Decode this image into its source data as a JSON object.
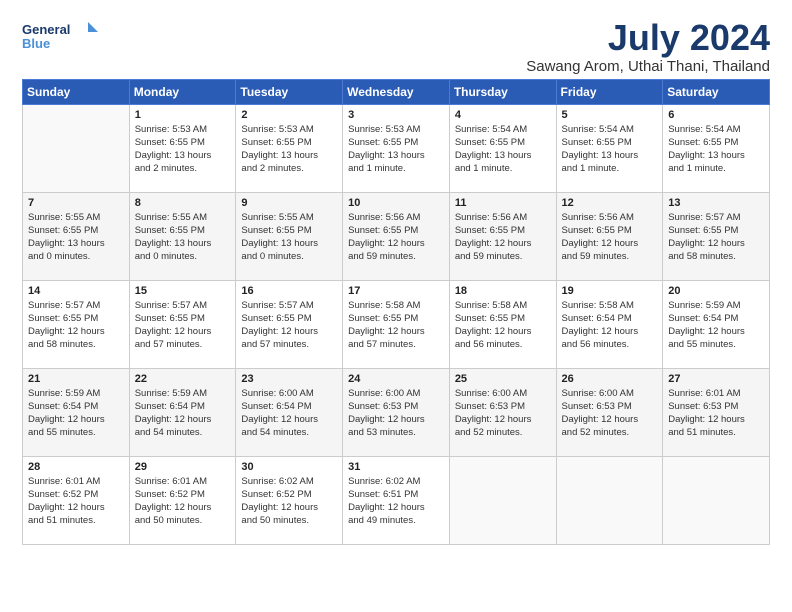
{
  "logo": {
    "line1": "General",
    "line2": "Blue"
  },
  "title": "July 2024",
  "subtitle": "Sawang Arom, Uthai Thani, Thailand",
  "weekdays": [
    "Sunday",
    "Monday",
    "Tuesday",
    "Wednesday",
    "Thursday",
    "Friday",
    "Saturday"
  ],
  "weeks": [
    [
      {
        "day": "",
        "info": ""
      },
      {
        "day": "1",
        "info": "Sunrise: 5:53 AM\nSunset: 6:55 PM\nDaylight: 13 hours\nand 2 minutes."
      },
      {
        "day": "2",
        "info": "Sunrise: 5:53 AM\nSunset: 6:55 PM\nDaylight: 13 hours\nand 2 minutes."
      },
      {
        "day": "3",
        "info": "Sunrise: 5:53 AM\nSunset: 6:55 PM\nDaylight: 13 hours\nand 1 minute."
      },
      {
        "day": "4",
        "info": "Sunrise: 5:54 AM\nSunset: 6:55 PM\nDaylight: 13 hours\nand 1 minute."
      },
      {
        "day": "5",
        "info": "Sunrise: 5:54 AM\nSunset: 6:55 PM\nDaylight: 13 hours\nand 1 minute."
      },
      {
        "day": "6",
        "info": "Sunrise: 5:54 AM\nSunset: 6:55 PM\nDaylight: 13 hours\nand 1 minute."
      }
    ],
    [
      {
        "day": "7",
        "info": "Sunrise: 5:55 AM\nSunset: 6:55 PM\nDaylight: 13 hours\nand 0 minutes."
      },
      {
        "day": "8",
        "info": "Sunrise: 5:55 AM\nSunset: 6:55 PM\nDaylight: 13 hours\nand 0 minutes."
      },
      {
        "day": "9",
        "info": "Sunrise: 5:55 AM\nSunset: 6:55 PM\nDaylight: 13 hours\nand 0 minutes."
      },
      {
        "day": "10",
        "info": "Sunrise: 5:56 AM\nSunset: 6:55 PM\nDaylight: 12 hours\nand 59 minutes."
      },
      {
        "day": "11",
        "info": "Sunrise: 5:56 AM\nSunset: 6:55 PM\nDaylight: 12 hours\nand 59 minutes."
      },
      {
        "day": "12",
        "info": "Sunrise: 5:56 AM\nSunset: 6:55 PM\nDaylight: 12 hours\nand 59 minutes."
      },
      {
        "day": "13",
        "info": "Sunrise: 5:57 AM\nSunset: 6:55 PM\nDaylight: 12 hours\nand 58 minutes."
      }
    ],
    [
      {
        "day": "14",
        "info": "Sunrise: 5:57 AM\nSunset: 6:55 PM\nDaylight: 12 hours\nand 58 minutes."
      },
      {
        "day": "15",
        "info": "Sunrise: 5:57 AM\nSunset: 6:55 PM\nDaylight: 12 hours\nand 57 minutes."
      },
      {
        "day": "16",
        "info": "Sunrise: 5:57 AM\nSunset: 6:55 PM\nDaylight: 12 hours\nand 57 minutes."
      },
      {
        "day": "17",
        "info": "Sunrise: 5:58 AM\nSunset: 6:55 PM\nDaylight: 12 hours\nand 57 minutes."
      },
      {
        "day": "18",
        "info": "Sunrise: 5:58 AM\nSunset: 6:55 PM\nDaylight: 12 hours\nand 56 minutes."
      },
      {
        "day": "19",
        "info": "Sunrise: 5:58 AM\nSunset: 6:54 PM\nDaylight: 12 hours\nand 56 minutes."
      },
      {
        "day": "20",
        "info": "Sunrise: 5:59 AM\nSunset: 6:54 PM\nDaylight: 12 hours\nand 55 minutes."
      }
    ],
    [
      {
        "day": "21",
        "info": "Sunrise: 5:59 AM\nSunset: 6:54 PM\nDaylight: 12 hours\nand 55 minutes."
      },
      {
        "day": "22",
        "info": "Sunrise: 5:59 AM\nSunset: 6:54 PM\nDaylight: 12 hours\nand 54 minutes."
      },
      {
        "day": "23",
        "info": "Sunrise: 6:00 AM\nSunset: 6:54 PM\nDaylight: 12 hours\nand 54 minutes."
      },
      {
        "day": "24",
        "info": "Sunrise: 6:00 AM\nSunset: 6:53 PM\nDaylight: 12 hours\nand 53 minutes."
      },
      {
        "day": "25",
        "info": "Sunrise: 6:00 AM\nSunset: 6:53 PM\nDaylight: 12 hours\nand 52 minutes."
      },
      {
        "day": "26",
        "info": "Sunrise: 6:00 AM\nSunset: 6:53 PM\nDaylight: 12 hours\nand 52 minutes."
      },
      {
        "day": "27",
        "info": "Sunrise: 6:01 AM\nSunset: 6:53 PM\nDaylight: 12 hours\nand 51 minutes."
      }
    ],
    [
      {
        "day": "28",
        "info": "Sunrise: 6:01 AM\nSunset: 6:52 PM\nDaylight: 12 hours\nand 51 minutes."
      },
      {
        "day": "29",
        "info": "Sunrise: 6:01 AM\nSunset: 6:52 PM\nDaylight: 12 hours\nand 50 minutes."
      },
      {
        "day": "30",
        "info": "Sunrise: 6:02 AM\nSunset: 6:52 PM\nDaylight: 12 hours\nand 50 minutes."
      },
      {
        "day": "31",
        "info": "Sunrise: 6:02 AM\nSunset: 6:51 PM\nDaylight: 12 hours\nand 49 minutes."
      },
      {
        "day": "",
        "info": ""
      },
      {
        "day": "",
        "info": ""
      },
      {
        "day": "",
        "info": ""
      }
    ]
  ]
}
